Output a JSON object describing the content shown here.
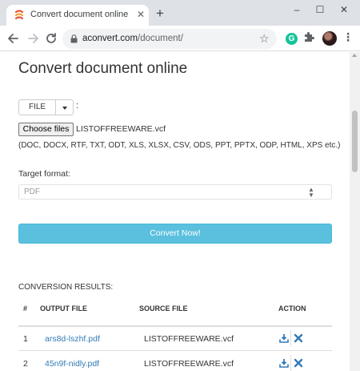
{
  "browser": {
    "tab_title": "Convert document online",
    "tab_close": "✕",
    "new_tab": "+",
    "window_controls": [
      "–",
      "☐",
      "✕"
    ],
    "url_domain": "aconvert.com",
    "url_path": "/document/",
    "extension_letter": "G",
    "icons": [
      "back-arrow-icon",
      "forward-arrow-icon",
      "reload-icon",
      "lock-icon",
      "star-icon",
      "puzzle-icon",
      "menu-dots-icon"
    ]
  },
  "page": {
    "title": "Convert document online",
    "file_source_label": "FILE",
    "file_source_colon": ":",
    "choose_files_label": "Choose files",
    "selected_file": "LISTOFFREEWARE.vcf",
    "supported_formats": "(DOC, DOCX, RTF, TXT, ODT, XLS, XLSX, CSV, ODS, PPT, PPTX, ODP, HTML, XPS etc.)",
    "target_format_label": "Target format:",
    "target_format_value": "PDF",
    "convert_button": "Convert Now!",
    "accent_color": "#5bc0de",
    "link_color": "#337ab7"
  },
  "results": {
    "title": "CONVERSION RESULTS:",
    "columns": [
      "#",
      "OUTPUT FILE",
      "SOURCE FILE",
      "ACTION"
    ],
    "rows": [
      {
        "num": "1",
        "output": "ars8d-lszhf.pdf",
        "source": "LISTOFFREEWARE.vcf",
        "actions": [
          "download-icon",
          "delete-icon"
        ]
      },
      {
        "num": "2",
        "output": "45n9f-nidly.pdf",
        "source": "LISTOFFREEWARE.vcf",
        "actions": [
          "download-icon",
          "delete-icon"
        ]
      }
    ]
  }
}
